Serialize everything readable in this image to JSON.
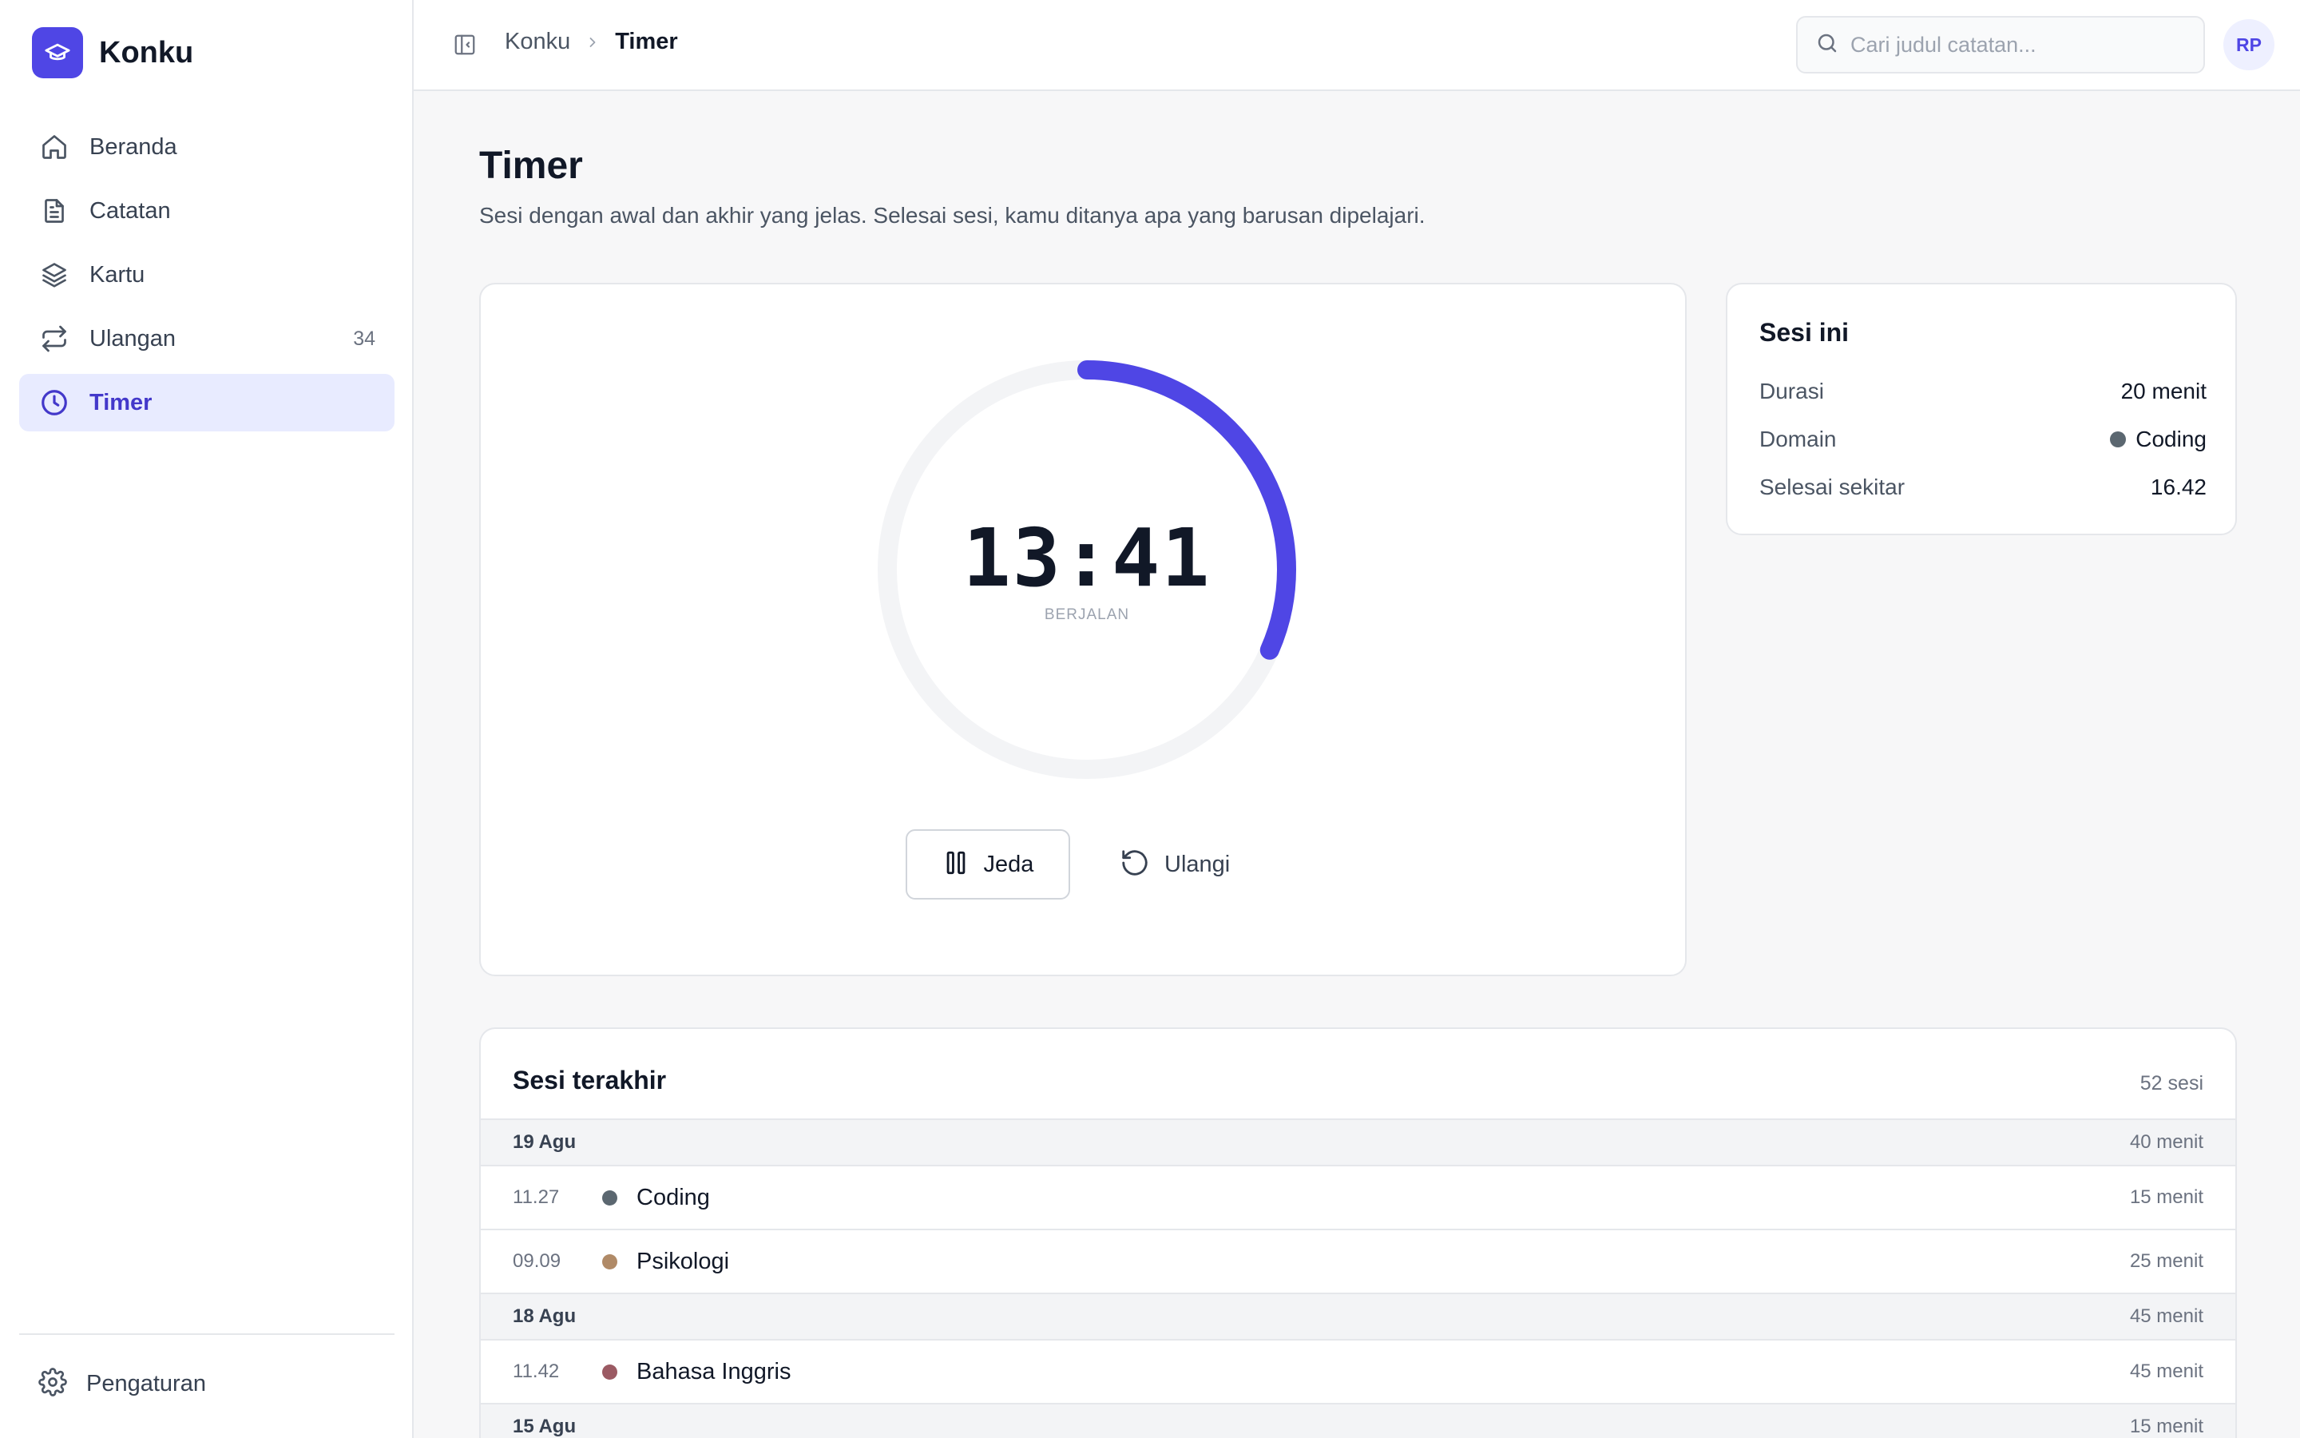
{
  "brand": {
    "name": "Konku"
  },
  "sidebar": {
    "items": [
      {
        "label": "Beranda",
        "icon": "home-icon"
      },
      {
        "label": "Catatan",
        "icon": "document-icon"
      },
      {
        "label": "Kartu",
        "icon": "layers-icon"
      },
      {
        "label": "Ulangan",
        "icon": "repeat-icon",
        "count": "34"
      },
      {
        "label": "Timer",
        "icon": "clock-icon",
        "active": true
      }
    ],
    "settings_label": "Pengaturan"
  },
  "header": {
    "breadcrumb_root": "Konku",
    "breadcrumb_current": "Timer",
    "search_placeholder": "Cari judul catatan...",
    "avatar_initials": "RP"
  },
  "page": {
    "title": "Timer",
    "subtitle": "Sesi dengan awal dan akhir yang jelas. Selesai sesi, kamu ditanya apa yang barusan dipelajari."
  },
  "timer": {
    "time": "13:41",
    "status": "BERJALAN",
    "progress_fraction": 0.316,
    "pause_label": "Jeda",
    "reset_label": "Ulangi",
    "accent_color": "#4f46e5"
  },
  "session": {
    "title": "Sesi ini",
    "duration_label": "Durasi",
    "duration_value": "20 menit",
    "domain_label": "Domain",
    "domain_value": "Coding",
    "domain_color": "#5b6770",
    "finish_label": "Selesai sekitar",
    "finish_value": "16.42"
  },
  "recent": {
    "title": "Sesi terakhir",
    "count": "52 sesi",
    "groups": [
      {
        "date": "19 Agu",
        "total": "40 menit",
        "entries": [
          {
            "time": "11.27",
            "label": "Coding",
            "duration": "15 menit",
            "color": "#5b6770"
          },
          {
            "time": "09.09",
            "label": "Psikologi",
            "duration": "25 menit",
            "color": "#b08a67"
          }
        ]
      },
      {
        "date": "18 Agu",
        "total": "45 menit",
        "entries": [
          {
            "time": "11.42",
            "label": "Bahasa Inggris",
            "duration": "45 menit",
            "color": "#9b5a63"
          }
        ]
      },
      {
        "date": "15 Agu",
        "total": "15 menit",
        "entries": []
      }
    ]
  }
}
